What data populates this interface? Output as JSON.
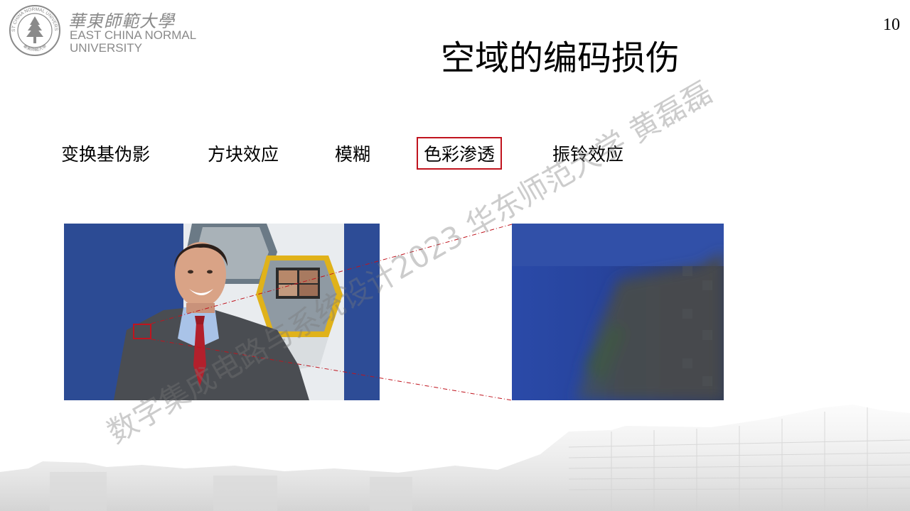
{
  "logo": {
    "name_cn": "華東師範大學",
    "name_en_line1": "EAST CHINA NORMAL",
    "name_en_line2": "UNIVERSITY",
    "seal_text": "EAST CHINA NORMAL UNIVERSITY",
    "seal_bottom_text": "華東師範大學"
  },
  "page_number": "10",
  "title": "空域的编码损伤",
  "categories": [
    {
      "label": "变换基伪影",
      "highlighted": false
    },
    {
      "label": "方块效应",
      "highlighted": false
    },
    {
      "label": "模糊",
      "highlighted": false
    },
    {
      "label": "色彩渗透",
      "highlighted": true
    },
    {
      "label": "振铃效应",
      "highlighted": false
    }
  ],
  "watermark": "数字集成电路与系统设计2023 华东师范大学 黄磊磊",
  "colors": {
    "highlight": "#c0141e",
    "backdrop_blue": "#2f4f9a",
    "suit_gray": "#4a4d52",
    "tie_red": "#b3202c"
  },
  "icons": {
    "seal": "university-seal-icon",
    "photo": "news-anchor-photo",
    "zoom": "zoomed-crop-image"
  }
}
